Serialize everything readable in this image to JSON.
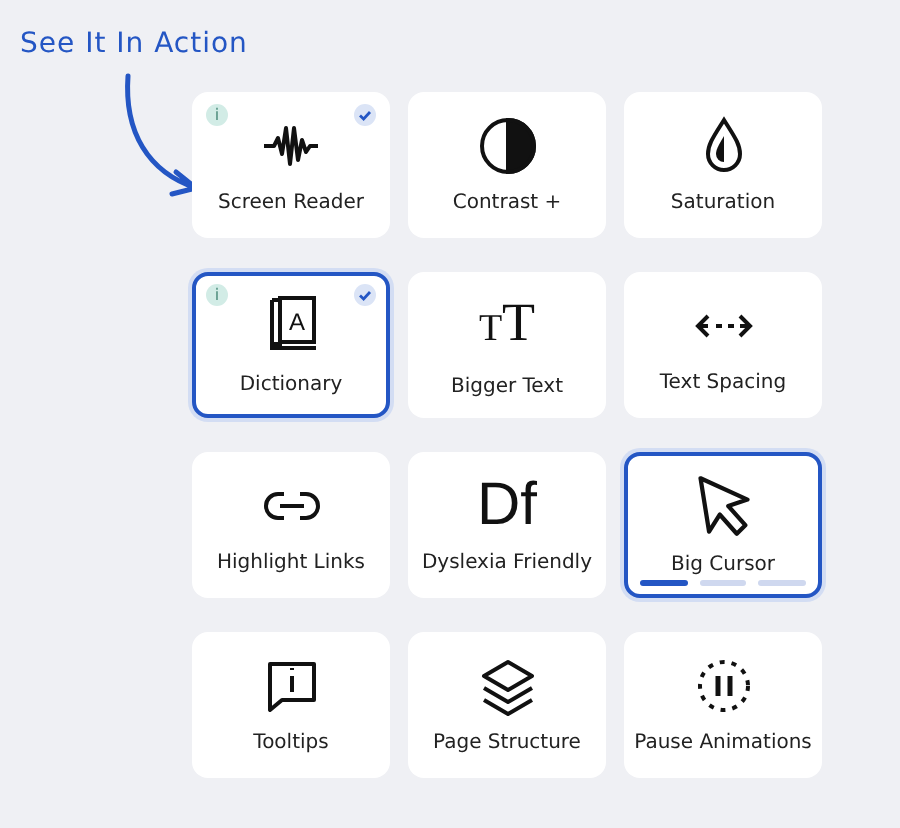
{
  "heading": "See It In Action",
  "tiles": [
    {
      "label": "Screen Reader",
      "selected": false,
      "info": "i",
      "checked": true
    },
    {
      "label": "Contrast +",
      "selected": false,
      "checked": false
    },
    {
      "label": "Saturation",
      "selected": false,
      "checked": false
    },
    {
      "label": "Dictionary",
      "selected": true,
      "info": "i",
      "checked": true,
      "glyph": "A"
    },
    {
      "label": "Bigger Text",
      "selected": false,
      "checked": false,
      "glyph": "TT"
    },
    {
      "label": "Text Spacing",
      "selected": false,
      "checked": false
    },
    {
      "label": "Highlight Links",
      "selected": false,
      "checked": false
    },
    {
      "label": "Dyslexia Friendly",
      "selected": false,
      "checked": false,
      "glyph": "Df"
    },
    {
      "label": "Big Cursor",
      "selected": true,
      "checked": false,
      "level": 0.33
    },
    {
      "label": "Tooltips",
      "selected": false,
      "checked": false
    },
    {
      "label": "Page Structure",
      "selected": false,
      "checked": false
    },
    {
      "label": "Pause Animations",
      "selected": false,
      "checked": false
    }
  ]
}
